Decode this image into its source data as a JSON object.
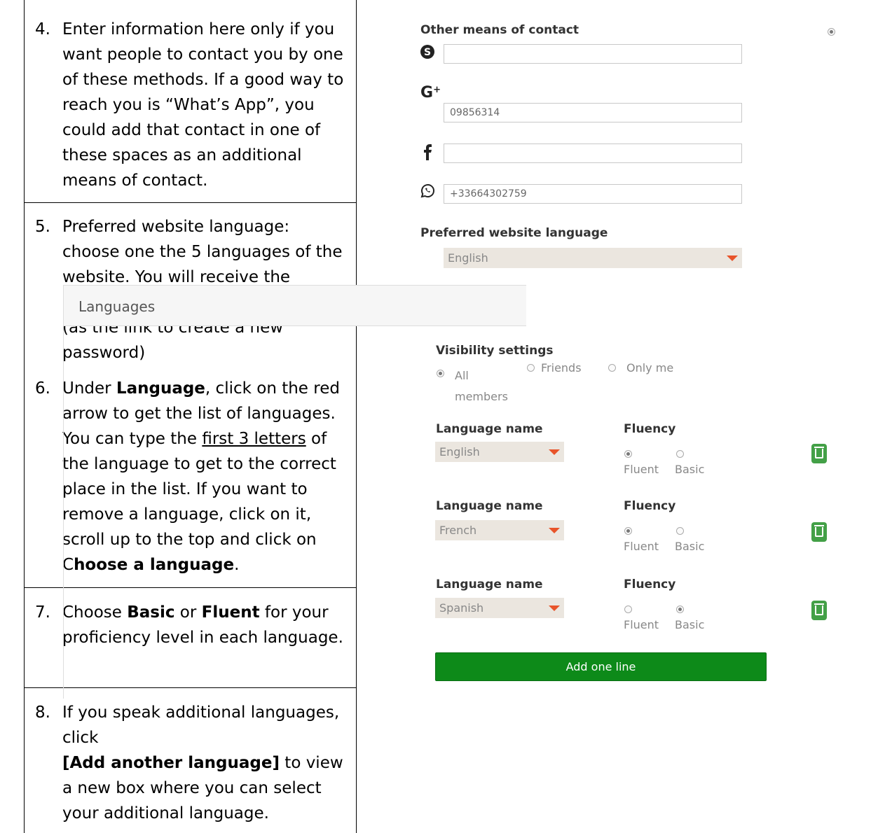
{
  "steps": [
    {
      "num": "4.",
      "text": "Enter information here only if you want people to contact you by one of these methods.  If a good way to reach you is “What’s App”, you could add that contact in one of these spaces as an additional means of contact."
    },
    {
      "num": "5.",
      "text": "Preferred website language: choose one the 5 languages of the website. You will receive the automatic emails in this language (as the link to create a new password)"
    },
    {
      "num": "6.",
      "parts": [
        "Under ",
        "Language",
        ", click on the red arrow to get the list of languages. You can type the ",
        "first 3 letters",
        " of the language to get to the correct place in the list. If you want to remove a language, click on it, scroll up to the top and click on C",
        "hoose a language",
        "."
      ]
    },
    {
      "num": "7.",
      "parts": [
        "Choose ",
        "Basic",
        " or ",
        "Fluent",
        " for your proficiency level in each language."
      ]
    },
    {
      "num": "8.",
      "parts": [
        "If you speak additional languages, click ",
        "[Add another language]",
        " to view a new box where you can select your additional language."
      ]
    }
  ],
  "form": {
    "contact_label": "Other means of contact",
    "skype_value": "",
    "googleplus_value": "09856314",
    "facebook_value": "",
    "whatsapp_value": "+33664302759",
    "website_language_label": "Preferred website language",
    "website_language_value": "English",
    "languages_title": "Languages",
    "visibility_label": "Visibility settings",
    "visibility_options": [
      "All members",
      "Friends",
      "Only me"
    ],
    "visibility_selected": "All members",
    "language_name_label": "Language name",
    "fluency_label": "Fluency",
    "fluency_options": [
      "Fluent",
      "Basic"
    ],
    "rows": [
      {
        "language": "English",
        "fluency": "Fluent"
      },
      {
        "language": "French",
        "fluency": "Fluent"
      },
      {
        "language": "Spanish",
        "fluency": "Basic"
      }
    ],
    "add_button_label": "Add one line",
    "colors": {
      "accent_green": "#0d8a19",
      "arrow_red": "#e8542a",
      "select_bg": "#ebe6df"
    }
  },
  "icons": [
    "skype-icon",
    "google-plus-icon",
    "facebook-icon",
    "whatsapp-icon",
    "trash-icon"
  ]
}
